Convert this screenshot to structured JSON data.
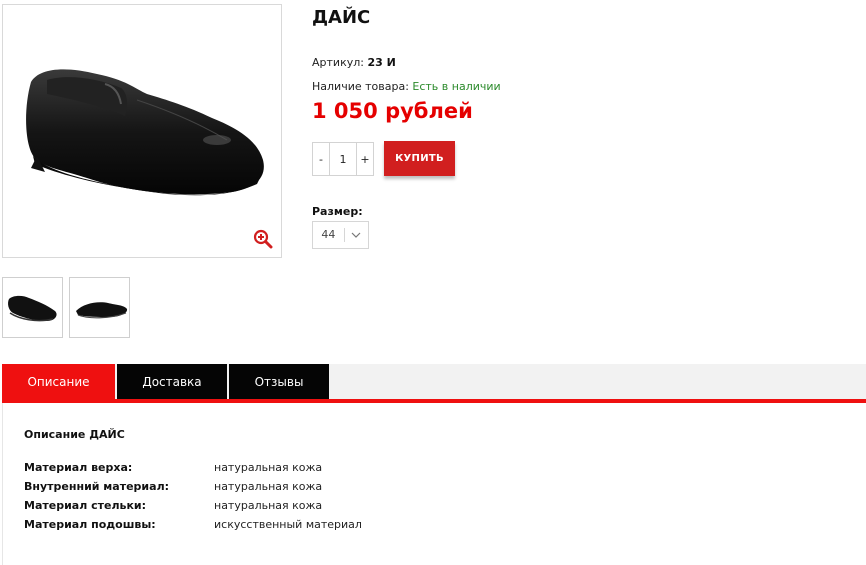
{
  "product": {
    "title": "ДАЙС",
    "article_label": "Артикул:",
    "article_value": "23 И",
    "stock_label": "Наличие товара:",
    "stock_value": "Есть в наличии",
    "price": "1 050 рублей"
  },
  "purchase": {
    "minus": "-",
    "quantity": "1",
    "plus": "+",
    "buy_label": "КУПИТЬ"
  },
  "size": {
    "label": "Размер:",
    "selected": "44"
  },
  "tabs": [
    {
      "label": "Описание"
    },
    {
      "label": "Доставка"
    },
    {
      "label": "Отзывы"
    }
  ],
  "description": {
    "title": "Описание ДАЙС",
    "specs": [
      {
        "key": "Материал верха:",
        "value": "натуральная кожа"
      },
      {
        "key": "Внутренний материал:",
        "value": "натуральная кожа"
      },
      {
        "key": "Материал стельки:",
        "value": "натуральная кожа"
      },
      {
        "key": "Материал подошвы:",
        "value": "искусственный материал"
      }
    ]
  },
  "colors": {
    "accent_red": "#ef1010",
    "buy_button": "#d11f1f",
    "price": "#e50000",
    "in_stock": "#2b8a2b",
    "tab_dark": "#050505"
  },
  "icons": {
    "zoom": "zoom-in-icon",
    "select": "chevron-down-icon"
  }
}
